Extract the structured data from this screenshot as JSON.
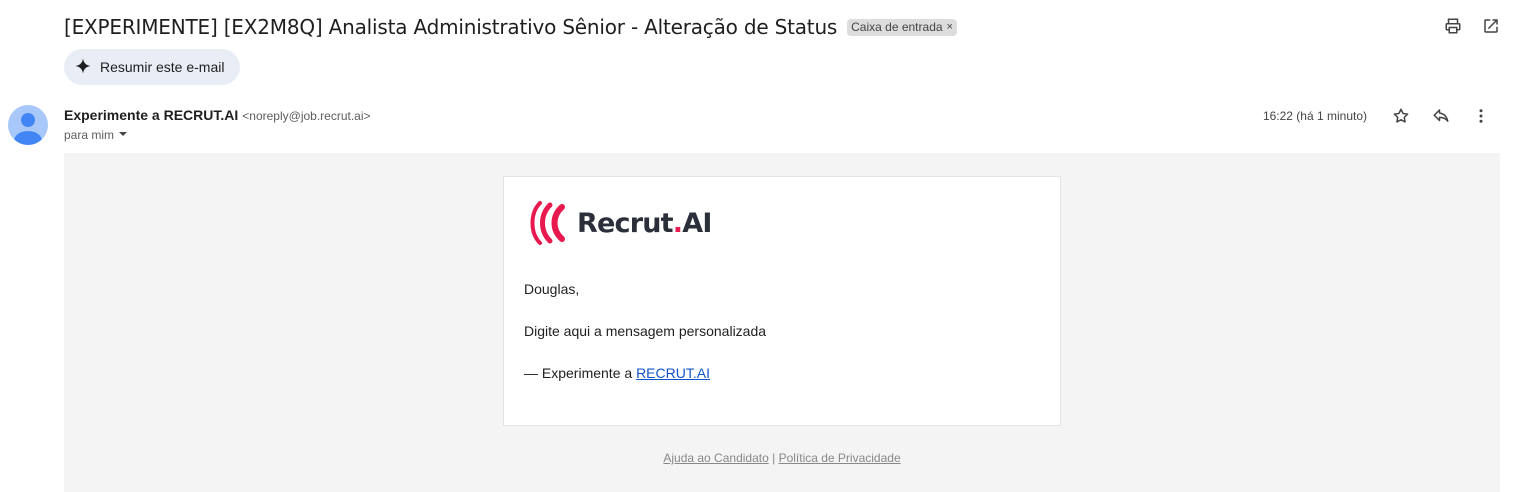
{
  "email": {
    "subject": "[EXPERIMENTE] [EX2M8Q] Analista Administrativo Sênior - Alteração de Status",
    "label": "Caixa de entrada",
    "label_close": "×",
    "summary_button": "Resumir este e-mail",
    "sender_name": "Experimente a RECRUT.AI",
    "sender_email": "<noreply@job.recrut.ai>",
    "recipient": "para mim",
    "timestamp": "16:22 (há 1 minuto)"
  },
  "body": {
    "logo_main": "Recrut",
    "logo_dot": ".",
    "logo_ai": "AI",
    "greeting": "Douglas,",
    "message": "Digite aqui a mensagem personalizada",
    "signature_prefix": "— Experimente a ",
    "signature_link": "RECRUT.AI",
    "footer_help": "Ajuda ao Candidato",
    "footer_sep": " | ",
    "footer_privacy": "Política de Privacidade"
  },
  "icons": {
    "print": "printer-icon",
    "open_new": "open-in-new-window-icon",
    "sparkle": "sparkle-icon",
    "star": "star-icon",
    "reply": "reply-icon",
    "more": "more-vertical-icon",
    "dropdown": "caret-down-icon",
    "avatar": "person-icon"
  },
  "colors": {
    "brand_pink": "#e8194f",
    "brand_dark": "#2b2f3a",
    "link": "#1155cc",
    "summary_bg": "#e9eef6",
    "avatar_bg": "#a8c7fa"
  }
}
